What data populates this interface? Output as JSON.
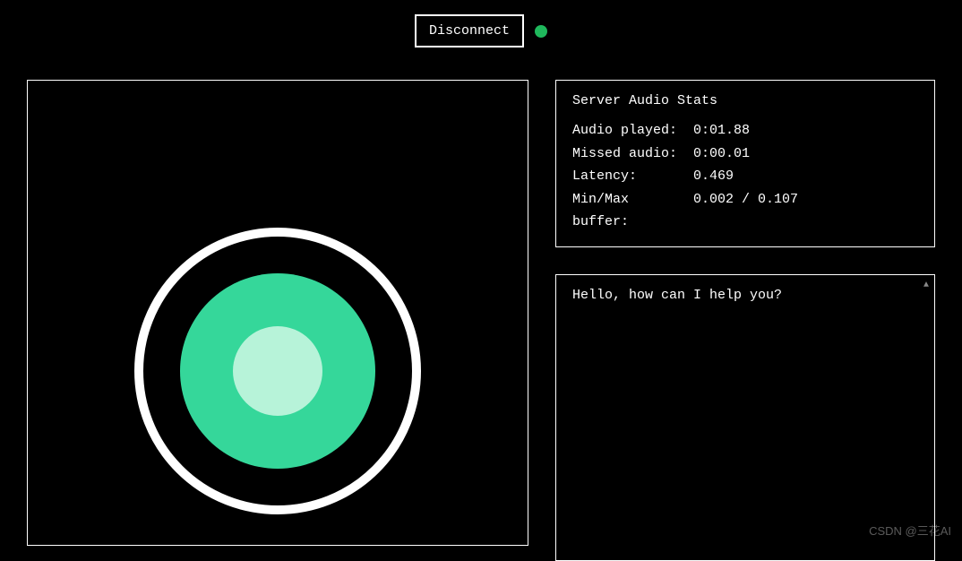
{
  "header": {
    "disconnect_label": "Disconnect",
    "status_color": "#1fb85c"
  },
  "visualizer": {
    "colors": {
      "outer_ring": "#ffffff",
      "mid_fill": "#35d79a",
      "inner_fill": "#b7f3d9"
    }
  },
  "stats": {
    "title": "Server Audio Stats",
    "rows": [
      {
        "label": "Audio played:",
        "value": "0:01.88"
      },
      {
        "label": "Missed audio:",
        "value": "0:00.01"
      },
      {
        "label": "Latency:",
        "value": "0.469"
      },
      {
        "label": "Min/Max buffer:",
        "value": "0.002 / 0.107"
      }
    ]
  },
  "transcript": {
    "text": "Hello, how can I help you?"
  },
  "watermark": "CSDN @三花AI"
}
